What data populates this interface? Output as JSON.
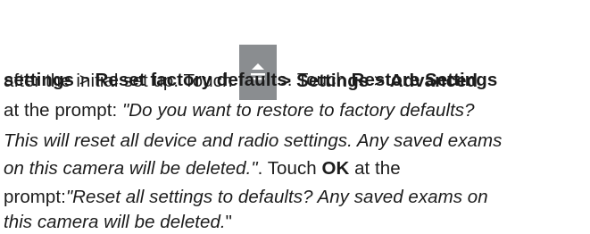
{
  "instruction": {
    "line1_prefix": "after the initial set up. Touch ",
    "line1_icon": "menu-up-arrow-icon",
    "line1_settings": "> Settings",
    "line1_sep": " > ",
    "line1_advanced": "Advanced",
    "line2_settings": "settings",
    "line2_sep": " > ",
    "line2_reset": "Reset factory defaults",
    "line2_touch": ". Touch ",
    "line2_restore": "Restore Settings",
    "line3_prefix": "at the prompt: ",
    "line3_italic": "\"Do you want to restore to factory defaults?",
    "line4_italic": "This will reset all device and radio settings. Any saved exams",
    "line5_italic": "on this camera will be deleted.\"",
    "line5_suffix": ". Touch ",
    "line5_ok": "OK",
    "line5_end": " at the",
    "line6_prefix": "prompt:",
    "line6_italic": "\"Reset all settings to defaults? Any saved exams on",
    "line7_italic": "this camera will be deleted.",
    "line7_end": "\""
  }
}
